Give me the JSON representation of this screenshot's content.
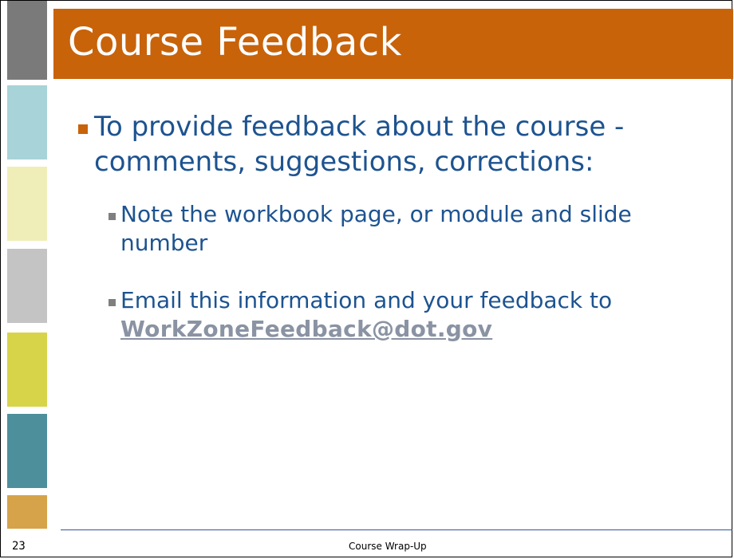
{
  "slide": {
    "title": "Course Feedback",
    "bullets": [
      {
        "text": "To provide feedback about the course - comments, suggestions, corrections:"
      }
    ],
    "sub_bullets": [
      {
        "text": "Note the workbook page, or module and slide number"
      },
      {
        "text_before_link": "Email this information and your feedback to",
        "link": "WorkZoneFeedback@dot.gov"
      }
    ]
  },
  "footer": {
    "slide_number": "23",
    "center_text": "Course Wrap-Up"
  },
  "colors": {
    "title_bar": "#c8630a",
    "body_text": "#1d5390",
    "link": "#8a93a3",
    "rail": [
      "#7a7a7a",
      "#a8d3d8",
      "#f0eeb8",
      "#c4c4c4",
      "#d8d44a",
      "#4e8f9c",
      "#d6a34a"
    ]
  }
}
